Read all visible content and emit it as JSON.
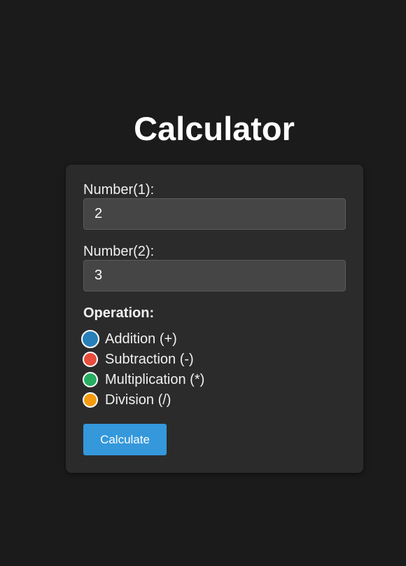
{
  "page": {
    "title": "Calculator"
  },
  "form": {
    "number1": {
      "label": "Number(1):",
      "value": "2"
    },
    "number2": {
      "label": "Number(2):",
      "value": "3"
    },
    "operation": {
      "heading": "Operation:",
      "selected": "addition",
      "options": [
        {
          "id": "addition",
          "label": "Addition (+)",
          "color": "#2980b9"
        },
        {
          "id": "subtraction",
          "label": "Subtraction (-)",
          "color": "#e74c3c"
        },
        {
          "id": "multiplication",
          "label": "Multiplication (*)",
          "color": "#27ae60"
        },
        {
          "id": "division",
          "label": "Division (/)",
          "color": "#f39c12"
        }
      ]
    },
    "calculate_label": "Calculate"
  },
  "colors": {
    "background": "#1b1b1b",
    "card": "#2b2b2b",
    "input": "#454545",
    "accent": "#3498db"
  }
}
